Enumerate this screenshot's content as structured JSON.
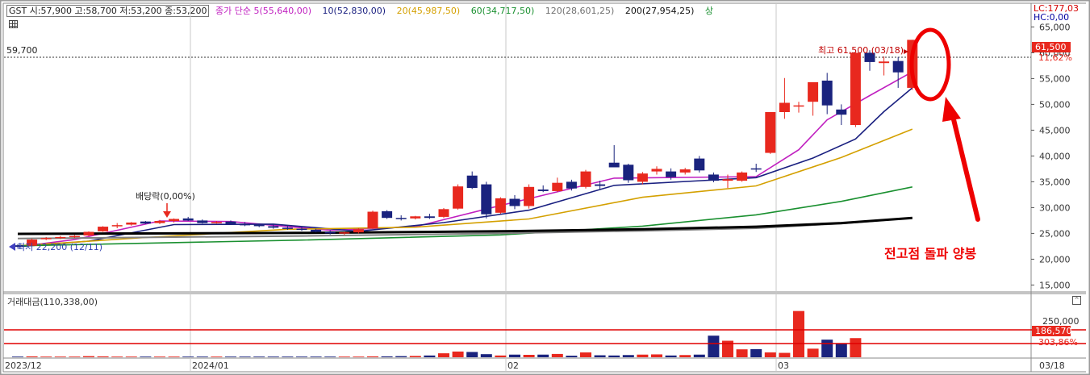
{
  "header": {
    "ohlc": "GST 시:57,900 고:58,700 저:53,200 종:53,200",
    "ma_items": [
      {
        "text": "종가 단순 5(55,640,00)",
        "color": "#c020c0"
      },
      {
        "text": "10(52,830,00)",
        "color": "#1a2080"
      },
      {
        "text": "20(45,987,50)",
        "color": "#d4a000"
      },
      {
        "text": "60(34,717,50)",
        "color": "#1a9030"
      },
      {
        "text": "120(28,601,25)",
        "color": "#707070"
      },
      {
        "text": "200(27,954,25)",
        "color": "#111111"
      },
      {
        "text": "상",
        "color": "#1a9030"
      }
    ],
    "lc": "LC:177,03",
    "hc": "HC:0,00"
  },
  "annotations": {
    "ref_line_label": "59,700",
    "high_label": "최고 61,500 (03/18)",
    "low_label": "최저 22,200 (12/11)",
    "dividend_label": "배당락(0,00%)",
    "callout_text": "전고점 돌파 양봉",
    "price_tag": "61,500",
    "pct_tag": "11,62%"
  },
  "volume_panel": {
    "title": "거래대금(110,338,00)",
    "tag_value": "186,570",
    "tag_pct": "303,86%",
    "scroll_glyph": "^"
  },
  "chart_data": {
    "type": "candlestick",
    "ylim": [
      13000,
      67000
    ],
    "y_ticks": [
      "65,000",
      "60,000",
      "55,000",
      "50,000",
      "45,000",
      "40,000",
      "35,000",
      "30,000",
      "25,000",
      "20,000",
      "15,000"
    ],
    "y_tick_values": [
      65000,
      60000,
      55000,
      50000,
      45000,
      40000,
      35000,
      30000,
      25000,
      20000,
      15000
    ],
    "x_labels": [
      {
        "label": "2023/12",
        "index": 0
      },
      {
        "label": "2024/01",
        "index": 13
      },
      {
        "label": "02",
        "index": 35
      },
      {
        "label": "03",
        "index": 54
      },
      {
        "label": "03/18",
        "index": 73
      }
    ],
    "up_color": "#e8281e",
    "down_color": "#1a237e",
    "candles": [
      [
        22700,
        22900,
        22200,
        22400
      ],
      [
        22600,
        24000,
        22500,
        23800
      ],
      [
        23900,
        24300,
        23700,
        24100
      ],
      [
        24100,
        24500,
        23900,
        24300
      ],
      [
        24300,
        24700,
        24100,
        24500
      ],
      [
        24600,
        25400,
        24500,
        25300
      ],
      [
        25400,
        26400,
        25300,
        26300
      ],
      [
        26400,
        27000,
        26000,
        26600
      ],
      [
        26700,
        27200,
        26500,
        27100
      ],
      [
        27300,
        27400,
        26800,
        26900
      ],
      [
        27000,
        27600,
        26800,
        27400
      ],
      [
        27400,
        27900,
        27100,
        27800
      ],
      [
        27900,
        28200,
        27400,
        27500
      ],
      [
        27500,
        27700,
        26900,
        27000
      ],
      [
        27100,
        27400,
        26900,
        27200
      ],
      [
        27300,
        27500,
        26700,
        26800
      ],
      [
        26800,
        27200,
        26400,
        26600
      ],
      [
        26700,
        26900,
        26200,
        26400
      ],
      [
        26400,
        26700,
        25900,
        26100
      ],
      [
        26100,
        26400,
        25700,
        25900
      ],
      [
        25900,
        26200,
        25500,
        25700
      ],
      [
        25700,
        25900,
        25200,
        25300
      ],
      [
        25300,
        25600,
        24800,
        25000
      ],
      [
        25000,
        25300,
        24700,
        25200
      ],
      [
        25200,
        26000,
        25000,
        25800
      ],
      [
        26000,
        29400,
        25900,
        29200
      ],
      [
        29300,
        29500,
        27800,
        28000
      ],
      [
        28000,
        28500,
        27500,
        27900
      ],
      [
        27900,
        28400,
        27700,
        28300
      ],
      [
        28300,
        28800,
        27800,
        28000
      ],
      [
        28200,
        29900,
        28000,
        29700
      ],
      [
        29800,
        34500,
        29600,
        34100
      ],
      [
        36200,
        37000,
        33600,
        33800
      ],
      [
        34500,
        35000,
        27900,
        28700
      ],
      [
        29000,
        32000,
        28800,
        31800
      ],
      [
        31700,
        32400,
        29700,
        30300
      ],
      [
        30300,
        34500,
        29800,
        34000
      ],
      [
        33500,
        34300,
        33000,
        33200
      ],
      [
        33200,
        35800,
        33000,
        34800
      ],
      [
        35000,
        35400,
        33300,
        33700
      ],
      [
        34000,
        37300,
        33700,
        37000
      ],
      [
        34500,
        35200,
        33600,
        34200
      ],
      [
        38700,
        42100,
        38000,
        37800
      ],
      [
        38300,
        38500,
        34800,
        35300
      ],
      [
        35000,
        36900,
        34500,
        36600
      ],
      [
        37000,
        38000,
        36400,
        37500
      ],
      [
        37000,
        37600,
        35400,
        35900
      ],
      [
        36800,
        37700,
        36400,
        37400
      ],
      [
        39500,
        40000,
        36800,
        37200
      ],
      [
        36400,
        36800,
        34900,
        35200
      ],
      [
        35200,
        36400,
        33800,
        35500
      ],
      [
        35200,
        37000,
        35000,
        36800
      ],
      [
        37600,
        38500,
        36900,
        37400
      ],
      [
        40600,
        46700,
        40400,
        48500
      ],
      [
        48500,
        55100,
        47200,
        50300
      ],
      [
        49700,
        50500,
        48400,
        49800
      ],
      [
        50500,
        51300,
        47800,
        54300
      ],
      [
        54600,
        56100,
        48100,
        49800
      ],
      [
        49000,
        50000,
        46000,
        48000
      ],
      [
        46000,
        60000,
        45600,
        60000
      ],
      [
        60000,
        60500,
        56500,
        58200
      ],
      [
        58000,
        59300,
        55600,
        58300
      ],
      [
        58400,
        59200,
        53200,
        56200
      ],
      [
        53200,
        62500,
        52800,
        62500
      ]
    ],
    "ma_series": [
      {
        "name": "5",
        "color": "#c020c0",
        "points": [
          [
            0,
            22400
          ],
          [
            4,
            23800
          ],
          [
            10,
            27400
          ],
          [
            15,
            27300
          ],
          [
            22,
            25600
          ],
          [
            28,
            26300
          ],
          [
            34,
            30400
          ],
          [
            42,
            35700
          ],
          [
            52,
            36000
          ],
          [
            55,
            41200
          ],
          [
            57,
            47000
          ],
          [
            60,
            51700
          ],
          [
            63,
            56300
          ]
        ]
      },
      {
        "name": "10",
        "color": "#1a2080",
        "points": [
          [
            0,
            22400
          ],
          [
            5,
            23500
          ],
          [
            11,
            26700
          ],
          [
            18,
            26800
          ],
          [
            24,
            25400
          ],
          [
            30,
            27100
          ],
          [
            36,
            29500
          ],
          [
            42,
            34300
          ],
          [
            52,
            35800
          ],
          [
            56,
            39600
          ],
          [
            59,
            43300
          ],
          [
            61,
            48600
          ],
          [
            63,
            53200
          ]
        ]
      },
      {
        "name": "20",
        "color": "#d4a000",
        "points": [
          [
            0,
            22600
          ],
          [
            9,
            24200
          ],
          [
            19,
            25800
          ],
          [
            28,
            26200
          ],
          [
            36,
            27800
          ],
          [
            44,
            32000
          ],
          [
            52,
            34200
          ],
          [
            58,
            39700
          ],
          [
            63,
            45200
          ]
        ]
      },
      {
        "name": "60",
        "color": "#1a9030",
        "points": [
          [
            0,
            22600
          ],
          [
            20,
            23700
          ],
          [
            34,
            24700
          ],
          [
            44,
            26400
          ],
          [
            52,
            28600
          ],
          [
            58,
            31200
          ],
          [
            63,
            34000
          ]
        ]
      },
      {
        "name": "120",
        "color": "#808080",
        "points": [
          [
            0,
            24000
          ],
          [
            20,
            24500
          ],
          [
            34,
            25000
          ],
          [
            44,
            25500
          ],
          [
            52,
            26000
          ],
          [
            58,
            26900
          ],
          [
            63,
            28000
          ]
        ]
      },
      {
        "name": "200",
        "color": "#000000",
        "points": [
          [
            0,
            24900
          ],
          [
            20,
            25100
          ],
          [
            34,
            25400
          ],
          [
            44,
            25800
          ],
          [
            52,
            26300
          ],
          [
            58,
            27000
          ],
          [
            63,
            28000
          ]
        ]
      }
    ],
    "volume": [
      3,
      4,
      3,
      3,
      3,
      5,
      4,
      3,
      3,
      3,
      3,
      3,
      3,
      3,
      3,
      3,
      3,
      3,
      3,
      3,
      3,
      3,
      3,
      3,
      3,
      4,
      4,
      5,
      6,
      8,
      18,
      26,
      24,
      14,
      8,
      12,
      11,
      12,
      15,
      7,
      22,
      9,
      8,
      10,
      12,
      13,
      8,
      10,
      12,
      98,
      75,
      36,
      37,
      22,
      20,
      210,
      39,
      80,
      63,
      87
    ]
  }
}
